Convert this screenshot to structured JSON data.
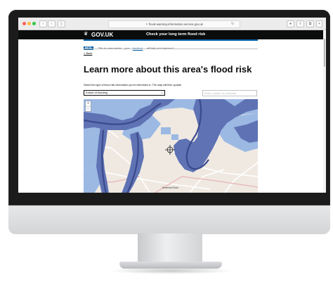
{
  "browser": {
    "url": "flood-warning-information.service.gov.uk",
    "back_icon": "chevron-left-icon",
    "forward_icon": "chevron-right-icon",
    "reload_icon": "reload-icon",
    "share_icon": "share-icon",
    "tabs_icon": "tabs-icon"
  },
  "header": {
    "logo": "GOV.UK",
    "logo_icon": "crown-icon",
    "service_name": "Check your long term flood risk",
    "accent_color": "#005ea5"
  },
  "beta_banner": {
    "tag": "BETA",
    "text_before": "This is a new service – your",
    "link": "feedback",
    "text_after": "will help us to improve it."
  },
  "back_link": "< Back",
  "page": {
    "title": "Learn more about this area's flood risk",
    "intro": "Select the type of flood risk information you're interested in. The map will then update."
  },
  "controls": {
    "select_value": "Extent of flooding",
    "search_placeholder": "Enter a place or postcode"
  },
  "map": {
    "zoom_in": "+",
    "zoom_out": "−",
    "marker_icon": "crosshair-icon",
    "water_color": "#5c6ea8",
    "high_risk_color": "#5e72b4",
    "low_risk_color": "#9bb9e3",
    "label": "Downham Road"
  }
}
